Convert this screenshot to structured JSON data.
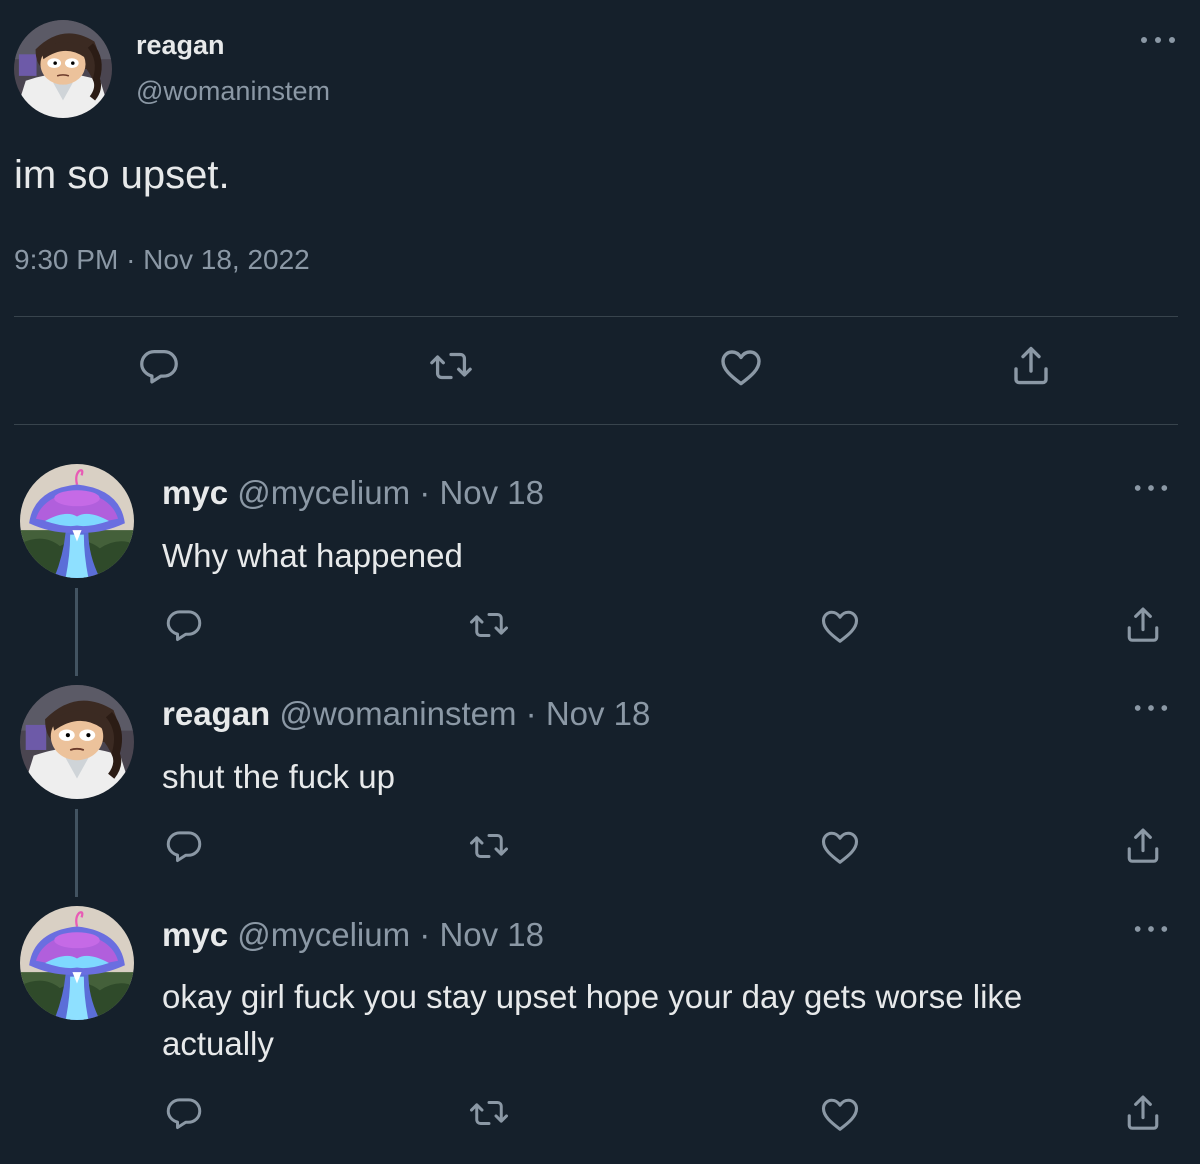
{
  "main_tweet": {
    "author_name": "reagan",
    "author_handle": "@womaninstem",
    "text": "im so upset.",
    "time": "9:30 PM",
    "separator": "·",
    "date": "Nov 18, 2022",
    "avatar_icon": "cartoon-woman-avatar",
    "actions": [
      "reply-icon",
      "retweet-icon",
      "like-icon",
      "share-icon"
    ]
  },
  "replies": [
    {
      "author_name": "myc",
      "author_handle": "@mycelium",
      "separator": "·",
      "date": "Nov 18",
      "text": "Why what happened",
      "avatar_icon": "mushroom-avatar"
    },
    {
      "author_name": "reagan",
      "author_handle": "@womaninstem",
      "separator": "·",
      "date": "Nov 18",
      "text": "shut the fuck up",
      "avatar_icon": "cartoon-woman-avatar"
    },
    {
      "author_name": "myc",
      "author_handle": "@mycelium",
      "separator": "·",
      "date": "Nov 18",
      "text": "okay girl fuck you stay upset hope your day gets worse like actually",
      "avatar_icon": "mushroom-avatar"
    }
  ],
  "colors": {
    "background": "#15202b",
    "text_primary": "#e7e9ea",
    "text_secondary": "#8b98a5",
    "divider": "#38444d",
    "thread_line": "#425361"
  }
}
